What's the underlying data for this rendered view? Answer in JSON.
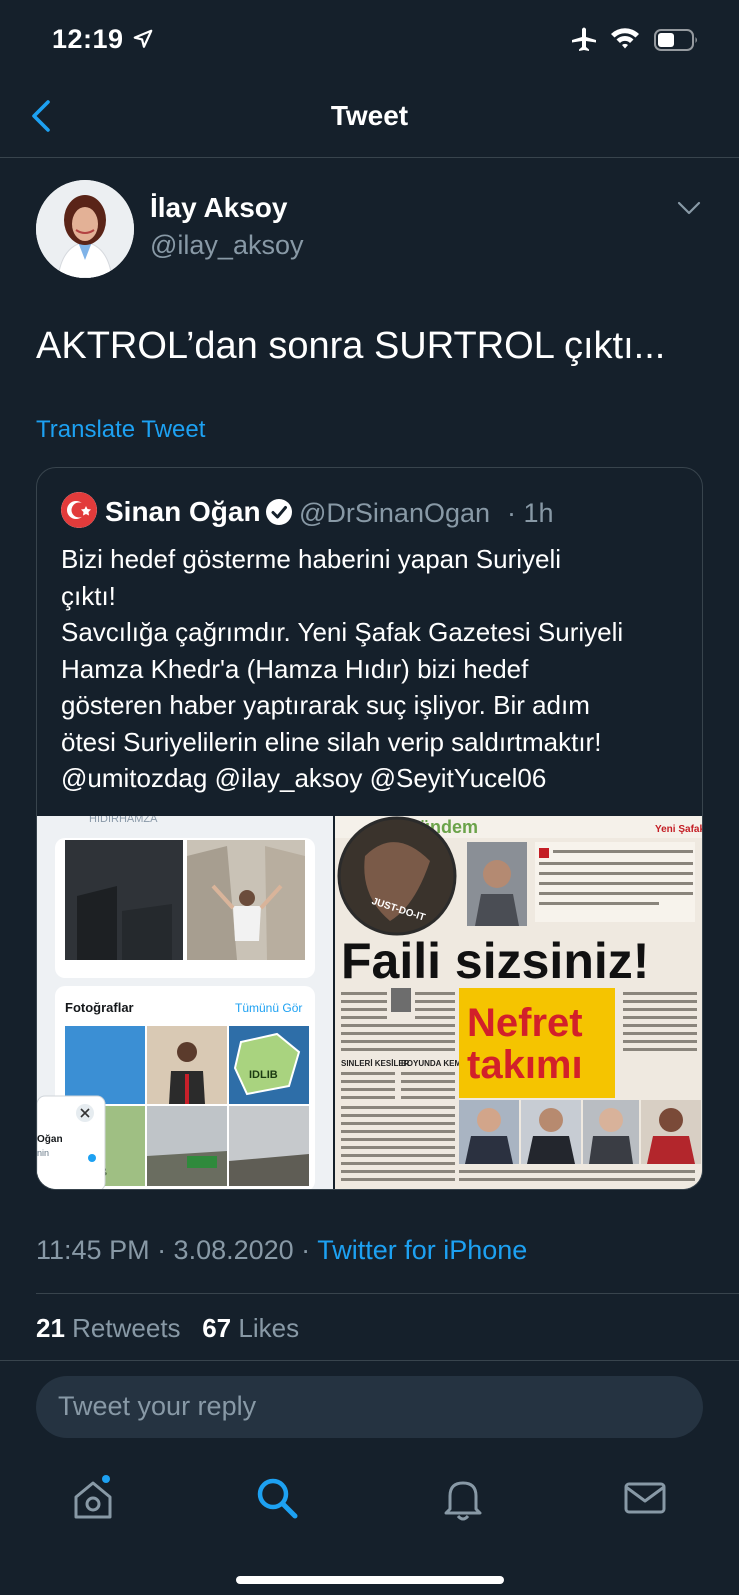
{
  "status_bar": {
    "time": "12:19"
  },
  "nav": {
    "title": "Tweet"
  },
  "author": {
    "name": "İlay Aksoy",
    "handle": "@ilay_aksoy"
  },
  "tweet": {
    "text": "AKTROL’dan sonra SURTROL çıktı...",
    "translate_label": "Translate Tweet",
    "time": "11:45 PM · 3.08.2020 · ",
    "source": "Twitter for iPhone"
  },
  "quote": {
    "name": "Sinan Oğan",
    "handle": "@DrSinanOgan",
    "time": "· 1h",
    "lines": [
      "Bizi hedef gösterme haberini yapan Suriyeli",
      "çıktı!",
      "Savcılığa çağrımdır. Yeni Şafak Gazetesi Suriyeli",
      "Hamza Khedr'a (Hamza Hıdır) bizi hedef",
      "gösteren haber yaptırarak suç işliyor. Bir adım",
      "ötesi Suriyelilerin eline silah verip saldırtmaktır!",
      "@umitozdag @ilay_aksoy @SeyitYucel06"
    ],
    "media_left": {
      "header": "HIDIRHAMZA",
      "photos_label": "Fotoğraflar",
      "see_all": "Tümünü Gör",
      "map_label": "IDLIB",
      "bottom_map_label": "IB",
      "popup_name": "Oğan",
      "popup_sub": "nin"
    },
    "media_right": {
      "section": "Gündem",
      "paper": "Yeni Şafak",
      "photo_caption": "JUST-DO-IT",
      "headline": "Faili sizsiniz!",
      "sub_headline_1": "Nefret",
      "sub_headline_2": "takımı",
      "col_heading_1": "SINLERİ KESİLER",
      "col_heading_2": "BOYUNDA KEMER"
    }
  },
  "stats": {
    "retweets_count": "21",
    "retweets_label": "Retweets",
    "likes_count": "67",
    "likes_label": "Likes"
  },
  "reply": {
    "placeholder": "Tweet your reply"
  },
  "colors": {
    "background": "#15202b",
    "accent": "#1da1f2",
    "secondary_text": "#8899a6",
    "border": "#38444d",
    "input_bg": "#253341"
  }
}
